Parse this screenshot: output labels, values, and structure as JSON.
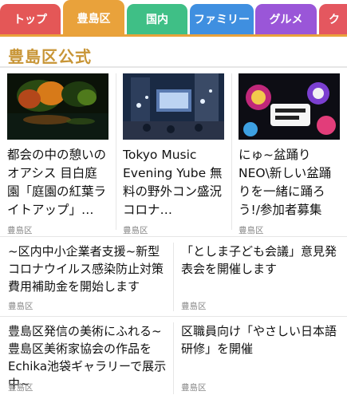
{
  "tabs": [
    {
      "label": "トップ",
      "color": "#e45757",
      "active": false
    },
    {
      "label": "豊島区",
      "color": "#e9a23b",
      "active": true
    },
    {
      "label": "国内",
      "color": "#3fbf86",
      "active": false
    },
    {
      "label": "ファミリー",
      "color": "#3f8fe0",
      "active": false
    },
    {
      "label": "グルメ",
      "color": "#9a56d8",
      "active": false
    },
    {
      "label": "ク",
      "color": "#e4575f",
      "active": false
    }
  ],
  "section": {
    "title": "豊島区公式"
  },
  "cards": [
    {
      "title": "都会の中の憩いのオアシス 目白庭園「庭園の紅葉ライトアップ」…",
      "source": "豊島区"
    },
    {
      "title": "Tokyo Music Evening Yube 無料の野外コン盛況 コロナ…",
      "source": "豊島区"
    },
    {
      "title": "にゅ~盆踊りNEO\\新しい盆踊りを一緒に踊ろう!/参加者募集中!!",
      "source": "豊島区"
    }
  ],
  "items": [
    {
      "title": "~区内中小企業者支援~新型コロナウイルス感染防止対策費用補助金を開始します",
      "source": "豊島区"
    },
    {
      "title": "「としま子ども会議」意見発表会を開催します",
      "source": "豊島区"
    },
    {
      "title": "豊島区発信の美術にふれる~豊島区美術家協会の作品をEchika池袋ギャラリーで展示中~",
      "source": "豊島区"
    },
    {
      "title": "区職員向け「やさしい日本語研修」を開催",
      "source": "豊島区"
    }
  ]
}
